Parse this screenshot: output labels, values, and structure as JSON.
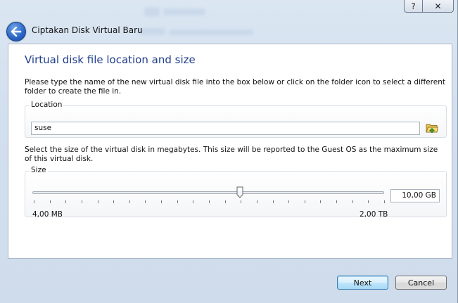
{
  "titlebar": {
    "help_label": "?",
    "close_label": "✕"
  },
  "wizard": {
    "title": "Ciptakan Disk Virtual Baru"
  },
  "page": {
    "heading": "Virtual disk file location and size",
    "location_description": "Please type the name of the new virtual disk file into the box below or click on the folder icon to select a different folder to create the file in.",
    "location_group_label": "Location",
    "location_value": "suse",
    "size_description": "Select the size of the virtual disk in megabytes. This size will be reported to the Guest OS as the maximum size of this virtual disk.",
    "size_group_label": "Size",
    "size_value": "10,00 GB",
    "slider_min_label": "4,00 MB",
    "slider_max_label": "2,00 TB",
    "slider_position": 0.59
  },
  "buttons": {
    "next_label": "Next",
    "cancel_label": "Cancel"
  },
  "colors": {
    "heading": "#1f3d8a",
    "accent": "#3c7fb1"
  }
}
